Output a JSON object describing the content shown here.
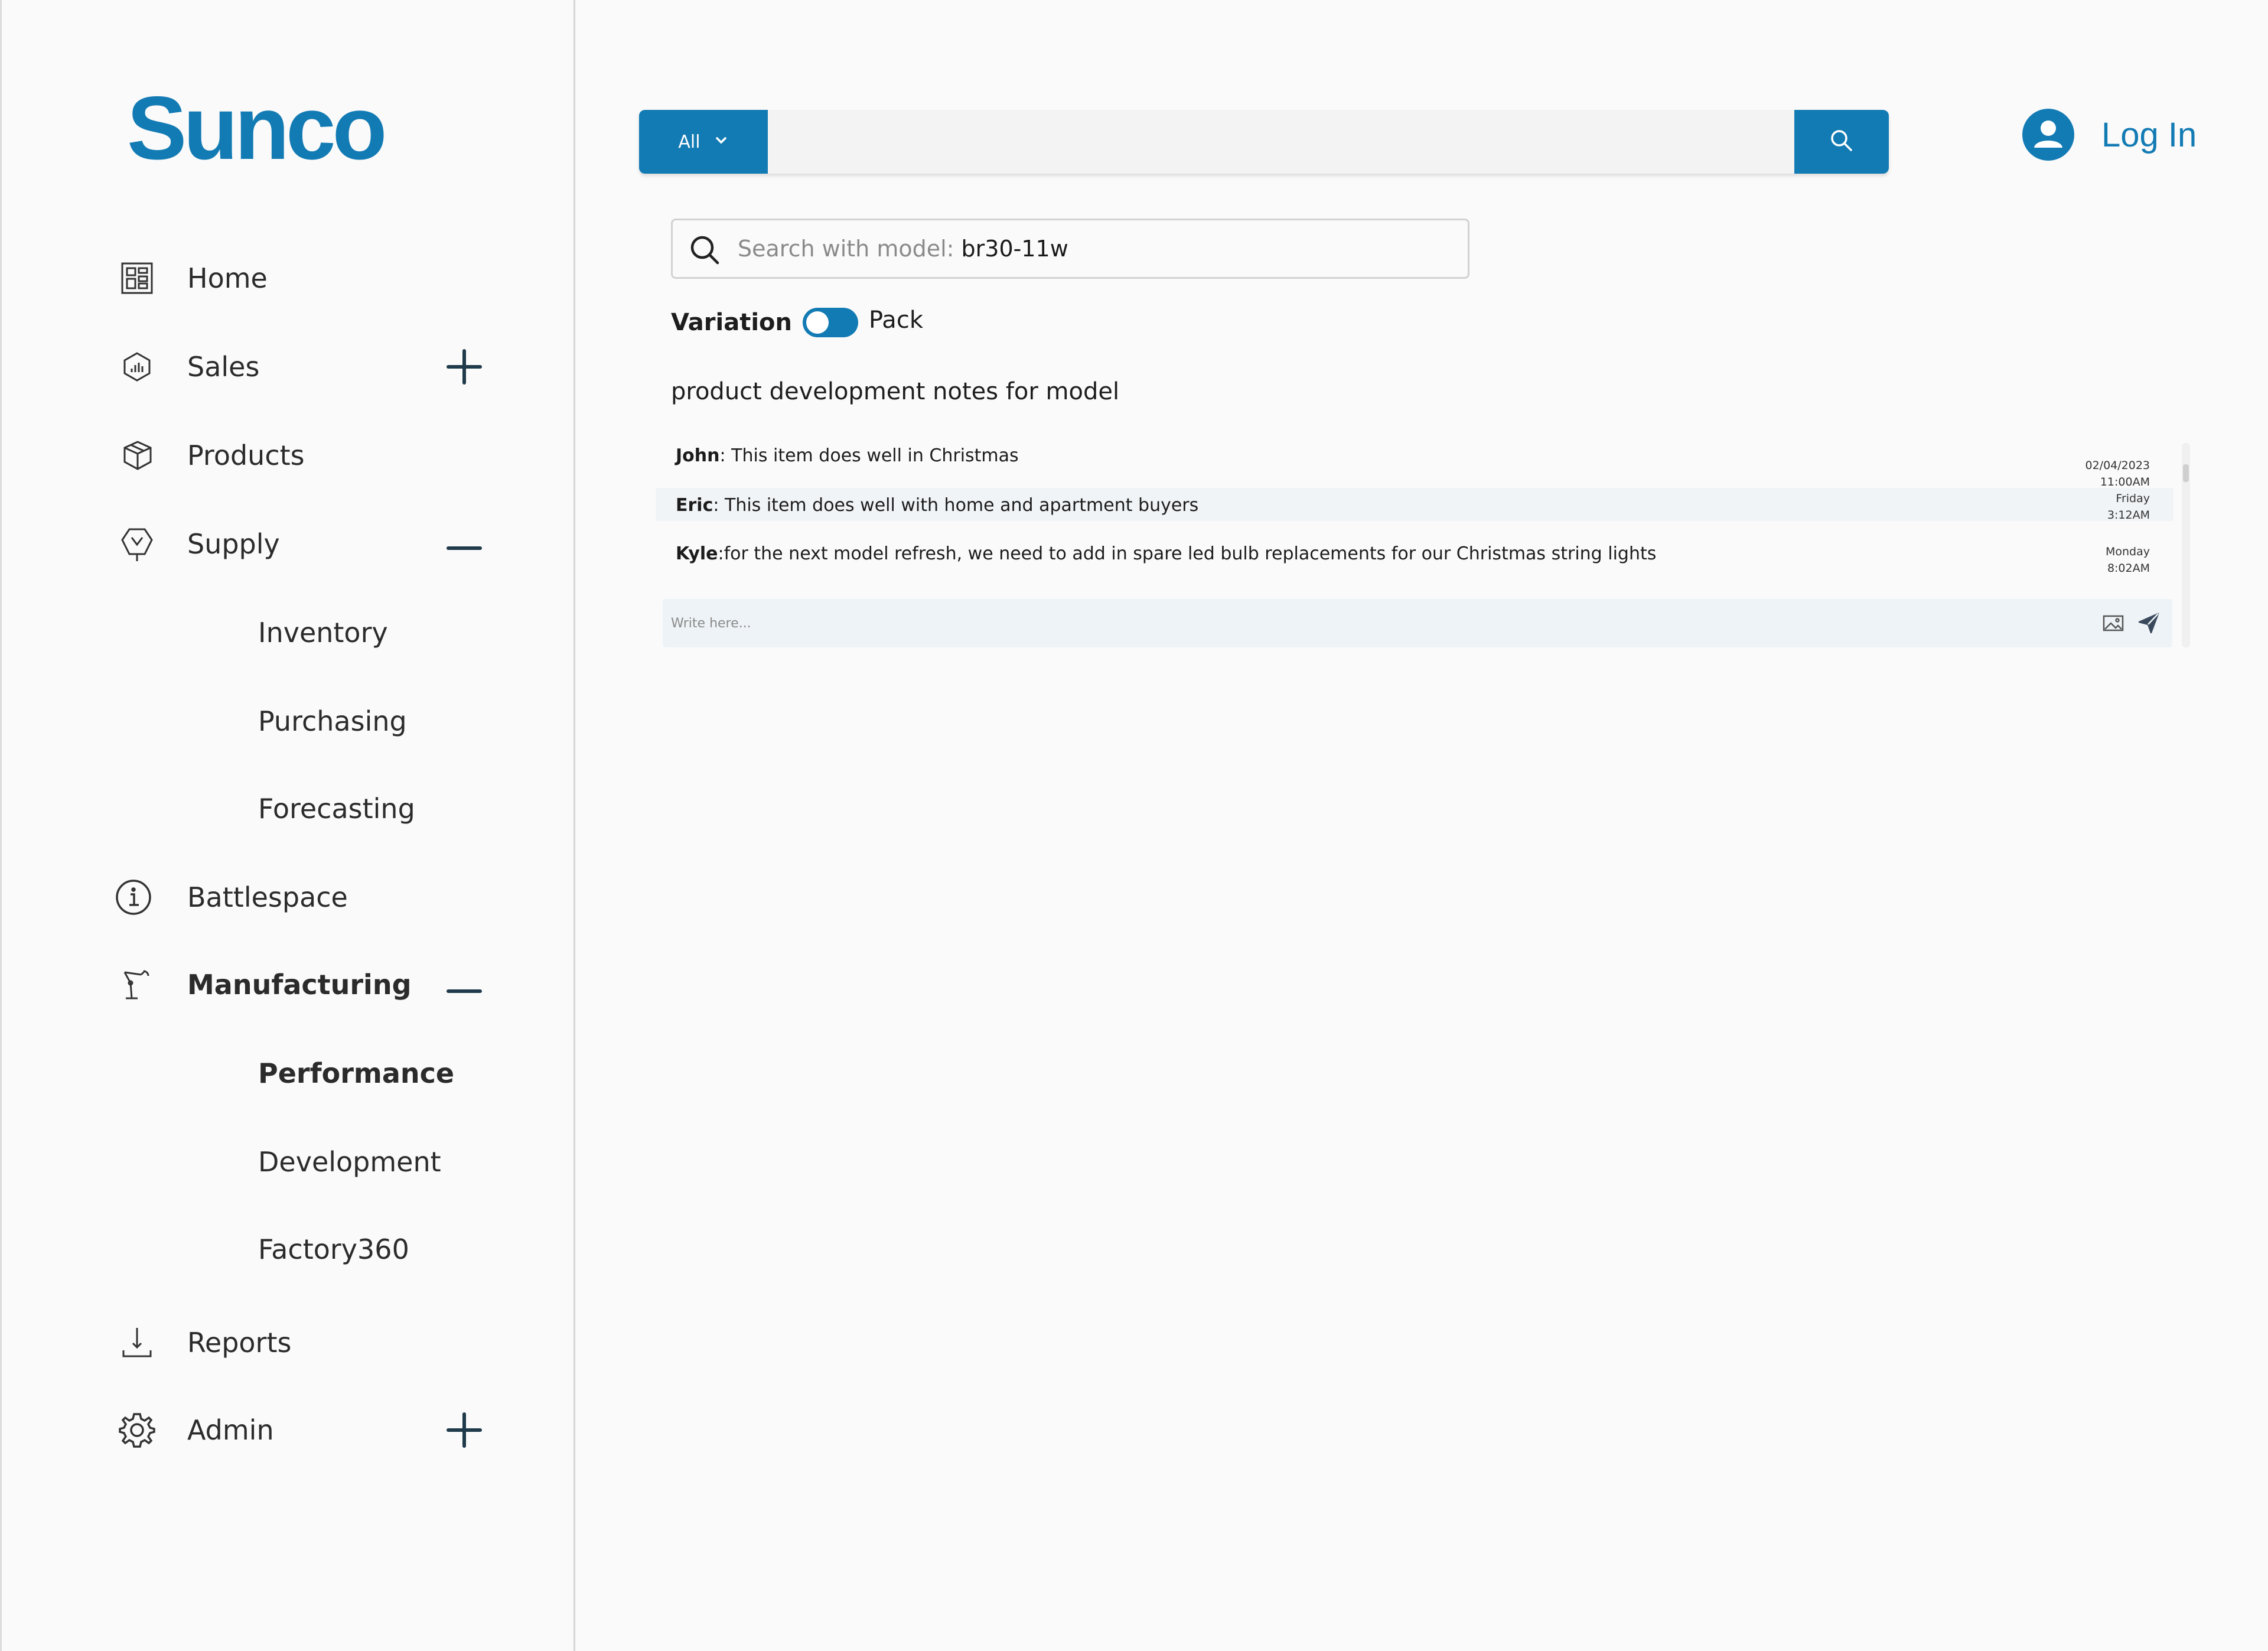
{
  "brand": {
    "name": "Sunco",
    "color": "#137bb4"
  },
  "sidebar": {
    "items": [
      {
        "id": "home",
        "label": "Home",
        "icon": "dashboard-grid-icon",
        "control": ""
      },
      {
        "id": "sales",
        "label": "Sales",
        "icon": "sales-chart-icon",
        "control": "expand"
      },
      {
        "id": "products",
        "label": "Products",
        "icon": "product-box-icon",
        "control": ""
      },
      {
        "id": "supply",
        "label": "Supply",
        "icon": "supply-icon",
        "control": "collapse",
        "children": [
          "Inventory",
          "Purchasing",
          "Forecasting"
        ]
      },
      {
        "id": "battlespace",
        "label": "Battlespace",
        "icon": "info-icon",
        "control": ""
      },
      {
        "id": "manufacturing",
        "label": "Manufacturing",
        "icon": "robot-arm-icon",
        "control": "collapse",
        "active": true,
        "children": [
          "Performance",
          "Development",
          "Factory360"
        ]
      },
      {
        "id": "reports",
        "label": "Reports",
        "icon": "download-icon",
        "control": ""
      },
      {
        "id": "admin",
        "label": "Admin",
        "icon": "gear-icon",
        "control": "expand"
      }
    ]
  },
  "topbar": {
    "category": "All",
    "search_value": "",
    "login_label": "Log In"
  },
  "model_search": {
    "placeholder": "Search with model: ",
    "value": "br30-11w"
  },
  "variation": {
    "left_label": "Variation",
    "right_label": "Pack",
    "on": true
  },
  "notes": {
    "title": "product development notes for model",
    "messages": [
      {
        "author": "John",
        "text": ": This item does well in Christmas",
        "date": "02/04/2023",
        "time": "11:00AM"
      },
      {
        "author": "Eric",
        "text": ": This item does well with home and apartment buyers",
        "date": "Friday",
        "time": "3:12AM"
      },
      {
        "author": "Kyle",
        "text": ":for the next model refresh, we need to add in spare led bulb replacements for our Christmas string lights",
        "date": "Monday",
        "time": "8:02AM"
      }
    ],
    "compose_placeholder": "Write here..."
  }
}
